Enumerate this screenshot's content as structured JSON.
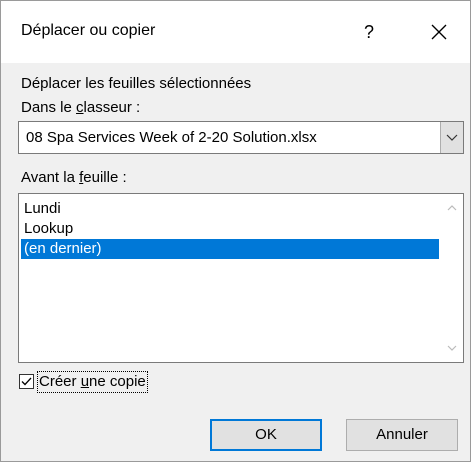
{
  "dialog": {
    "title": "Déplacer ou copier",
    "help_label": "?",
    "close_icon": "close-icon"
  },
  "section": {
    "heading": "Déplacer les feuilles sélectionnées"
  },
  "workbook": {
    "label_prefix": "Dans le ",
    "label_accel": "c",
    "label_suffix": "lasseur :",
    "selected_value": "08 Spa Services Week of 2-20 Solution.xlsx",
    "dropdown_icon": "chevron-down-icon"
  },
  "sheets": {
    "label_prefix": "Avant la ",
    "label_accel": "f",
    "label_suffix": "euille :",
    "items": [
      {
        "label": "Lundi",
        "selected": false
      },
      {
        "label": "Lookup",
        "selected": false
      },
      {
        "label": "(en dernier)",
        "selected": true
      }
    ],
    "scroll_up_icon": "chevron-up-icon",
    "scroll_down_icon": "chevron-down-icon"
  },
  "copy_option": {
    "label_prefix": "Créer ",
    "label_accel": "u",
    "label_suffix": "ne copie",
    "checked": true
  },
  "buttons": {
    "ok_label": "OK",
    "cancel_label": "Annuler"
  },
  "colors": {
    "selection": "#0078d7",
    "dialog_bg": "#f0f0f0",
    "button_bg": "#e1e1e1"
  }
}
